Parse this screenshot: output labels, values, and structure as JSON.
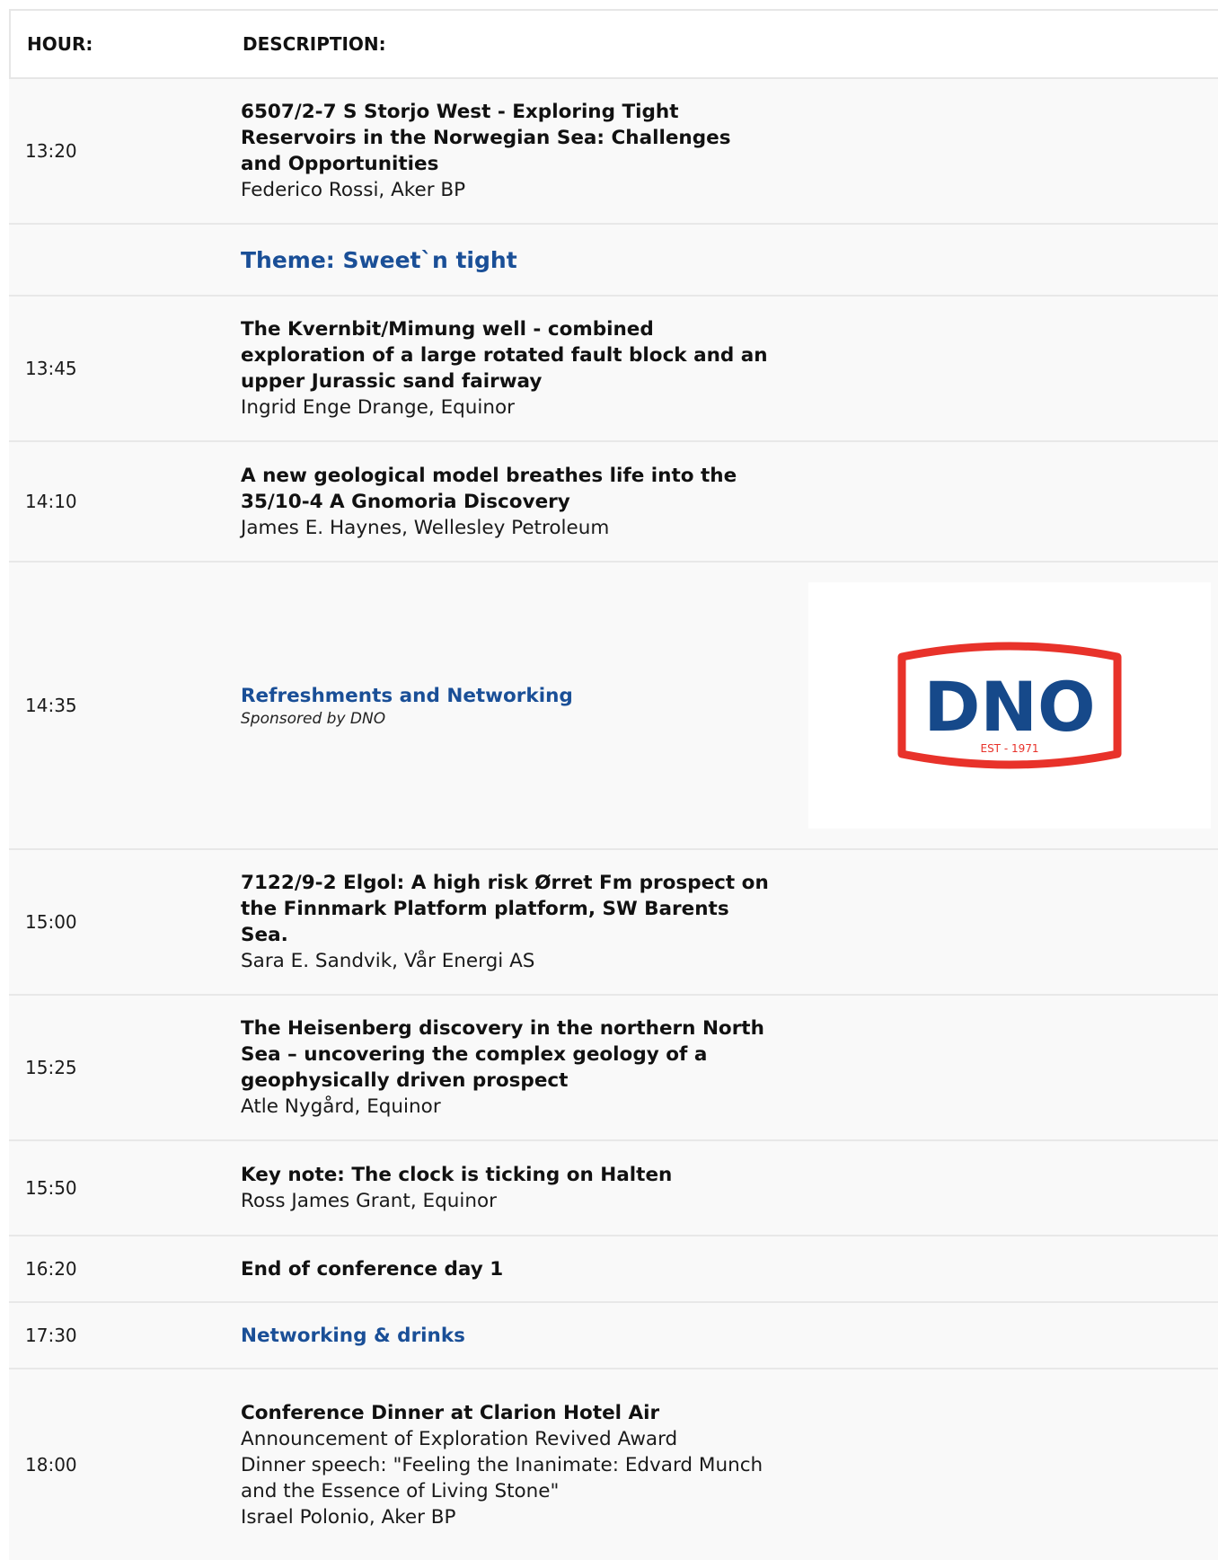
{
  "header": {
    "hour": "HOUR:",
    "description": "DESCRIPTION:"
  },
  "rows": [
    {
      "time": "13:20",
      "title": "6507/2-7 S Storjo West - Exploring Tight Reservoirs in the Norwegian Sea: Challenges and Opportunities",
      "subtitle": "Federico Rossi, Aker BP"
    },
    {
      "time": "",
      "title": "Theme: Sweet`n tight"
    },
    {
      "time": "13:45",
      "title": "The Kvernbit/Mimung well - combined exploration of a large rotated fault block and an upper Jurassic sand fairway",
      "subtitle": "Ingrid Enge Drange, Equinor"
    },
    {
      "time": "14:10",
      "title": "A new geological model breathes life into the 35/10-4 A Gnomoria Discovery",
      "subtitle": "James E. Haynes, Wellesley Petroleum"
    },
    {
      "time": "14:35",
      "title": "Refreshments and Networking",
      "subtitle": "Sponsored by DNO"
    },
    {
      "time": "15:00",
      "title": "7122/9-2 Elgol: A high risk Ørret Fm prospect on the Finnmark Platform platform, SW Barents Sea.",
      "subtitle": "Sara E. Sandvik, Vår Energi AS"
    },
    {
      "time": "15:25",
      "title": "The Heisenberg discovery in the northern North Sea – uncovering the complex geology of a geophysically driven prospect",
      "subtitle": "Atle Nygård, Equinor"
    },
    {
      "time": "15:50",
      "title": "Key note: The clock is ticking on Halten",
      "subtitle": "Ross James Grant, Equinor"
    },
    {
      "time": "16:20",
      "title": "End of conference day 1"
    },
    {
      "time": "17:30",
      "title": "Networking & drinks"
    },
    {
      "time": "18:00",
      "title": "Conference Dinner at Clarion Hotel Air",
      "lines": [
        "Announcement of Exploration Revived Award",
        "Dinner speech: \"Feeling the Inanimate: Edvard Munch and the Essence of Living Stone\"",
        "Israel Polonio, Aker BP"
      ]
    }
  ],
  "logo": {
    "text": "DNO",
    "tagline": "EST - 1971",
    "red": "#e8322a",
    "blue": "#16498a"
  },
  "colors": {
    "accent_blue": "#1a4f97",
    "row_bg": "#f9f9f9",
    "divider": "#e8e8e8"
  }
}
